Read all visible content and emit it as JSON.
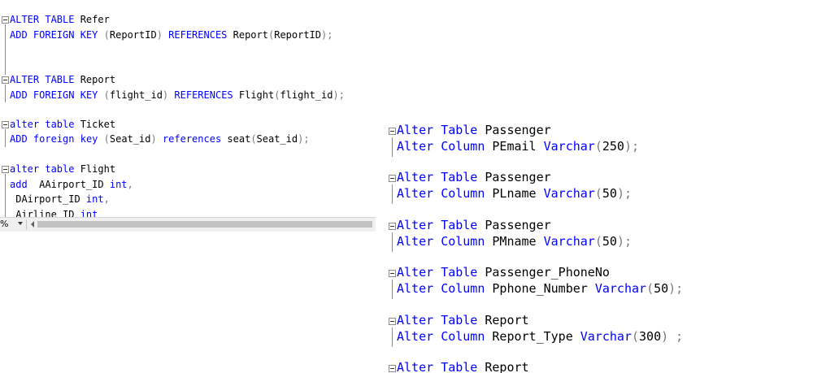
{
  "left_editor": {
    "lines": [
      [
        {
          "t": "ALTER",
          "c": "kw"
        },
        {
          "t": " ",
          "c": "plain"
        },
        {
          "t": "TABLE",
          "c": "kw"
        },
        {
          "t": " Refer",
          "c": "plain"
        }
      ],
      [
        {
          "t": "ADD",
          "c": "kw"
        },
        {
          "t": " ",
          "c": "plain"
        },
        {
          "t": "FOREIGN",
          "c": "kw"
        },
        {
          "t": " ",
          "c": "plain"
        },
        {
          "t": "KEY",
          "c": "kw"
        },
        {
          "t": " ",
          "c": "plain"
        },
        {
          "t": "(",
          "c": "op"
        },
        {
          "t": "ReportID",
          "c": "plain"
        },
        {
          "t": ")",
          "c": "op"
        },
        {
          "t": " ",
          "c": "plain"
        },
        {
          "t": "REFERENCES",
          "c": "kw"
        },
        {
          "t": " Report",
          "c": "plain"
        },
        {
          "t": "(",
          "c": "op"
        },
        {
          "t": "ReportID",
          "c": "plain"
        },
        {
          "t": ");",
          "c": "op"
        }
      ],
      [
        {
          "t": "ALTER",
          "c": "kw"
        },
        {
          "t": " ",
          "c": "plain"
        },
        {
          "t": "TABLE",
          "c": "kw"
        },
        {
          "t": " Report",
          "c": "plain"
        }
      ],
      [
        {
          "t": "ADD",
          "c": "kw"
        },
        {
          "t": " ",
          "c": "plain"
        },
        {
          "t": "FOREIGN",
          "c": "kw"
        },
        {
          "t": " ",
          "c": "plain"
        },
        {
          "t": "KEY",
          "c": "kw"
        },
        {
          "t": " ",
          "c": "plain"
        },
        {
          "t": "(",
          "c": "op"
        },
        {
          "t": "flight_id",
          "c": "plain"
        },
        {
          "t": ")",
          "c": "op"
        },
        {
          "t": " ",
          "c": "plain"
        },
        {
          "t": "REFERENCES",
          "c": "kw"
        },
        {
          "t": " Flight",
          "c": "plain"
        },
        {
          "t": "(",
          "c": "op"
        },
        {
          "t": "flight_id",
          "c": "plain"
        },
        {
          "t": ");",
          "c": "op"
        }
      ],
      [
        {
          "t": "alter",
          "c": "kw"
        },
        {
          "t": " ",
          "c": "plain"
        },
        {
          "t": "table",
          "c": "kw"
        },
        {
          "t": " Ticket",
          "c": "plain"
        }
      ],
      [
        {
          "t": "ADD",
          "c": "kw"
        },
        {
          "t": " ",
          "c": "plain"
        },
        {
          "t": "foreign",
          "c": "kw"
        },
        {
          "t": " ",
          "c": "plain"
        },
        {
          "t": "key",
          "c": "kw"
        },
        {
          "t": " ",
          "c": "plain"
        },
        {
          "t": "(",
          "c": "op"
        },
        {
          "t": "Seat_id",
          "c": "plain"
        },
        {
          "t": ")",
          "c": "op"
        },
        {
          "t": " ",
          "c": "plain"
        },
        {
          "t": "references",
          "c": "kw"
        },
        {
          "t": " seat",
          "c": "plain"
        },
        {
          "t": "(",
          "c": "op"
        },
        {
          "t": "Seat_id",
          "c": "plain"
        },
        {
          "t": ");",
          "c": "op"
        }
      ],
      [
        {
          "t": "alter",
          "c": "kw"
        },
        {
          "t": " ",
          "c": "plain"
        },
        {
          "t": "table",
          "c": "kw"
        },
        {
          "t": " Flight",
          "c": "plain"
        }
      ],
      [
        {
          "t": "add",
          "c": "kw"
        },
        {
          "t": "  AAirport_ID ",
          "c": "plain"
        },
        {
          "t": "int",
          "c": "kw"
        },
        {
          "t": ",",
          "c": "op"
        }
      ],
      [
        {
          "t": " DAirport_ID ",
          "c": "plain"
        },
        {
          "t": "int",
          "c": "kw"
        },
        {
          "t": ",",
          "c": "op"
        }
      ],
      [
        {
          "t": " Airline_ID ",
          "c": "plain"
        },
        {
          "t": "int",
          "c": "kw"
        }
      ]
    ]
  },
  "right_editor": {
    "lines": [
      [
        {
          "t": "Alter",
          "c": "kw"
        },
        {
          "t": " ",
          "c": "plain"
        },
        {
          "t": "Table",
          "c": "kw"
        },
        {
          "t": " Passenger",
          "c": "plain"
        }
      ],
      [
        {
          "t": "Alter",
          "c": "kw"
        },
        {
          "t": " ",
          "c": "plain"
        },
        {
          "t": "Column",
          "c": "kw"
        },
        {
          "t": " PEmail ",
          "c": "plain"
        },
        {
          "t": "Varchar",
          "c": "kw"
        },
        {
          "t": "(",
          "c": "op"
        },
        {
          "t": "250",
          "c": "plain"
        },
        {
          "t": ");",
          "c": "op"
        }
      ],
      [
        {
          "t": "Alter",
          "c": "kw"
        },
        {
          "t": " ",
          "c": "plain"
        },
        {
          "t": "Table",
          "c": "kw"
        },
        {
          "t": " Passenger",
          "c": "plain"
        }
      ],
      [
        {
          "t": "Alter",
          "c": "kw"
        },
        {
          "t": " ",
          "c": "plain"
        },
        {
          "t": "Column",
          "c": "kw"
        },
        {
          "t": " PLname ",
          "c": "plain"
        },
        {
          "t": "Varchar",
          "c": "kw"
        },
        {
          "t": "(",
          "c": "op"
        },
        {
          "t": "50",
          "c": "plain"
        },
        {
          "t": ");",
          "c": "op"
        }
      ],
      [
        {
          "t": "Alter",
          "c": "kw"
        },
        {
          "t": " ",
          "c": "plain"
        },
        {
          "t": "Table",
          "c": "kw"
        },
        {
          "t": " Passenger",
          "c": "plain"
        }
      ],
      [
        {
          "t": "Alter",
          "c": "kw"
        },
        {
          "t": " ",
          "c": "plain"
        },
        {
          "t": "Column",
          "c": "kw"
        },
        {
          "t": " PMname ",
          "c": "plain"
        },
        {
          "t": "Varchar",
          "c": "kw"
        },
        {
          "t": "(",
          "c": "op"
        },
        {
          "t": "50",
          "c": "plain"
        },
        {
          "t": ");",
          "c": "op"
        }
      ],
      [
        {
          "t": "Alter",
          "c": "kw"
        },
        {
          "t": " ",
          "c": "plain"
        },
        {
          "t": "Table",
          "c": "kw"
        },
        {
          "t": " Passenger_PhoneNo",
          "c": "plain"
        }
      ],
      [
        {
          "t": "Alter",
          "c": "kw"
        },
        {
          "t": " ",
          "c": "plain"
        },
        {
          "t": "Column",
          "c": "kw"
        },
        {
          "t": " Pphone_Number ",
          "c": "plain"
        },
        {
          "t": "Varchar",
          "c": "kw"
        },
        {
          "t": "(",
          "c": "op"
        },
        {
          "t": "50",
          "c": "plain"
        },
        {
          "t": ");",
          "c": "op"
        }
      ],
      [
        {
          "t": "Alter",
          "c": "kw"
        },
        {
          "t": " ",
          "c": "plain"
        },
        {
          "t": "Table",
          "c": "kw"
        },
        {
          "t": " Report",
          "c": "plain"
        }
      ],
      [
        {
          "t": "Alter",
          "c": "kw"
        },
        {
          "t": " ",
          "c": "plain"
        },
        {
          "t": "Column",
          "c": "kw"
        },
        {
          "t": " Report_Type ",
          "c": "plain"
        },
        {
          "t": "Varchar",
          "c": "kw"
        },
        {
          "t": "(",
          "c": "op"
        },
        {
          "t": "300",
          "c": "plain"
        },
        {
          "t": ")",
          "c": "op"
        },
        {
          "t": " ;",
          "c": "op"
        }
      ],
      [
        {
          "t": "Alter",
          "c": "kw"
        },
        {
          "t": " ",
          "c": "plain"
        },
        {
          "t": "Table",
          "c": "kw"
        },
        {
          "t": " Report",
          "c": "plain"
        }
      ]
    ]
  },
  "status_bar": {
    "zoom_label": "%"
  },
  "colors": {
    "keyword": "#0000ff",
    "identifier": "#000000",
    "operator": "#7a7a7a",
    "gutter_line": "#8a8a8a"
  },
  "icons": [
    "collapse-box-icon",
    "dropdown-arrow-icon",
    "scroll-left-arrow-icon"
  ]
}
